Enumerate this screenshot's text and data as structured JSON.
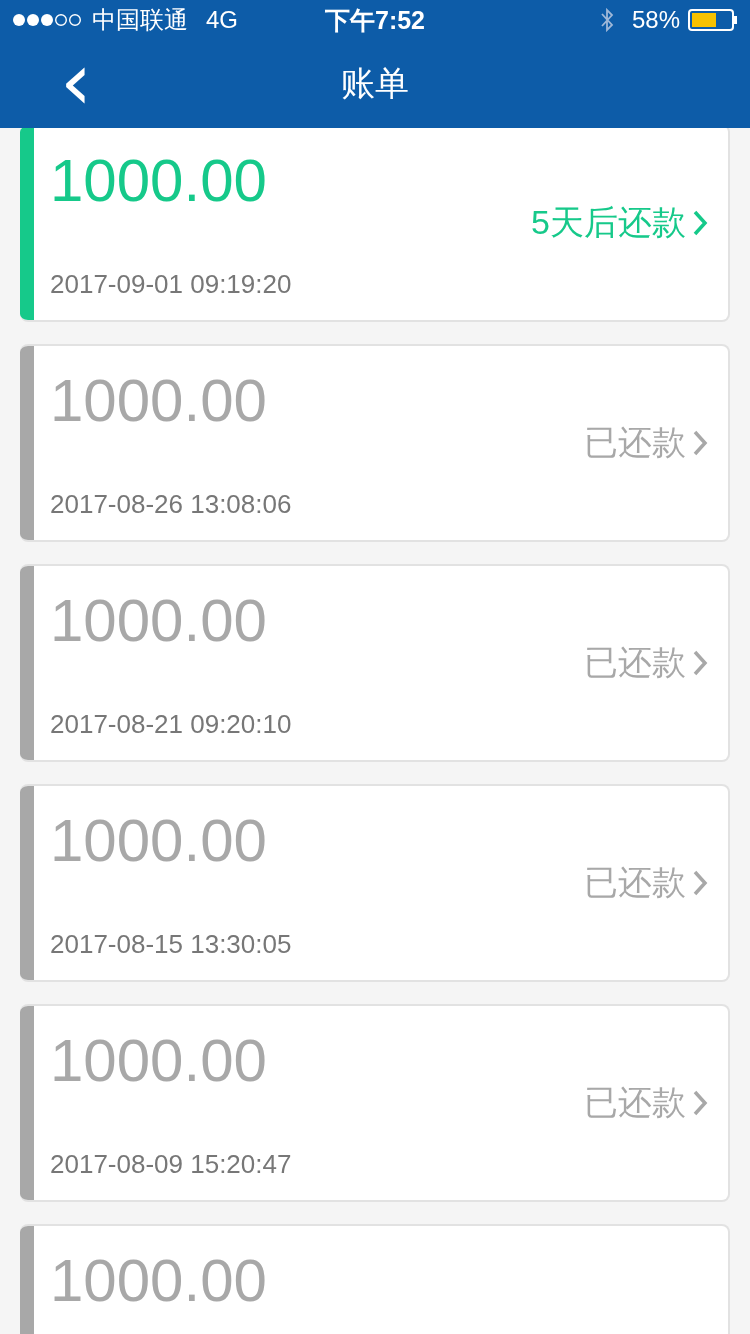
{
  "status_bar": {
    "carrier": "中国联通",
    "network": "4G",
    "time": "下午7:52",
    "battery": "58%"
  },
  "nav": {
    "back": "‹",
    "title": "账单"
  },
  "bills": [
    {
      "amount": "1000.00",
      "status": "5天后还款",
      "date": "2017-09-01 09:19:20",
      "kind": "due"
    },
    {
      "amount": "1000.00",
      "status": "已还款",
      "date": "2017-08-26 13:08:06",
      "kind": "paid"
    },
    {
      "amount": "1000.00",
      "status": "已还款",
      "date": "2017-08-21 09:20:10",
      "kind": "paid"
    },
    {
      "amount": "1000.00",
      "status": "已还款",
      "date": "2017-08-15 13:30:05",
      "kind": "paid"
    },
    {
      "amount": "1000.00",
      "status": "已还款",
      "date": "2017-08-09 15:20:47",
      "kind": "paid"
    },
    {
      "amount": "1000.00",
      "kind": "paid"
    }
  ]
}
